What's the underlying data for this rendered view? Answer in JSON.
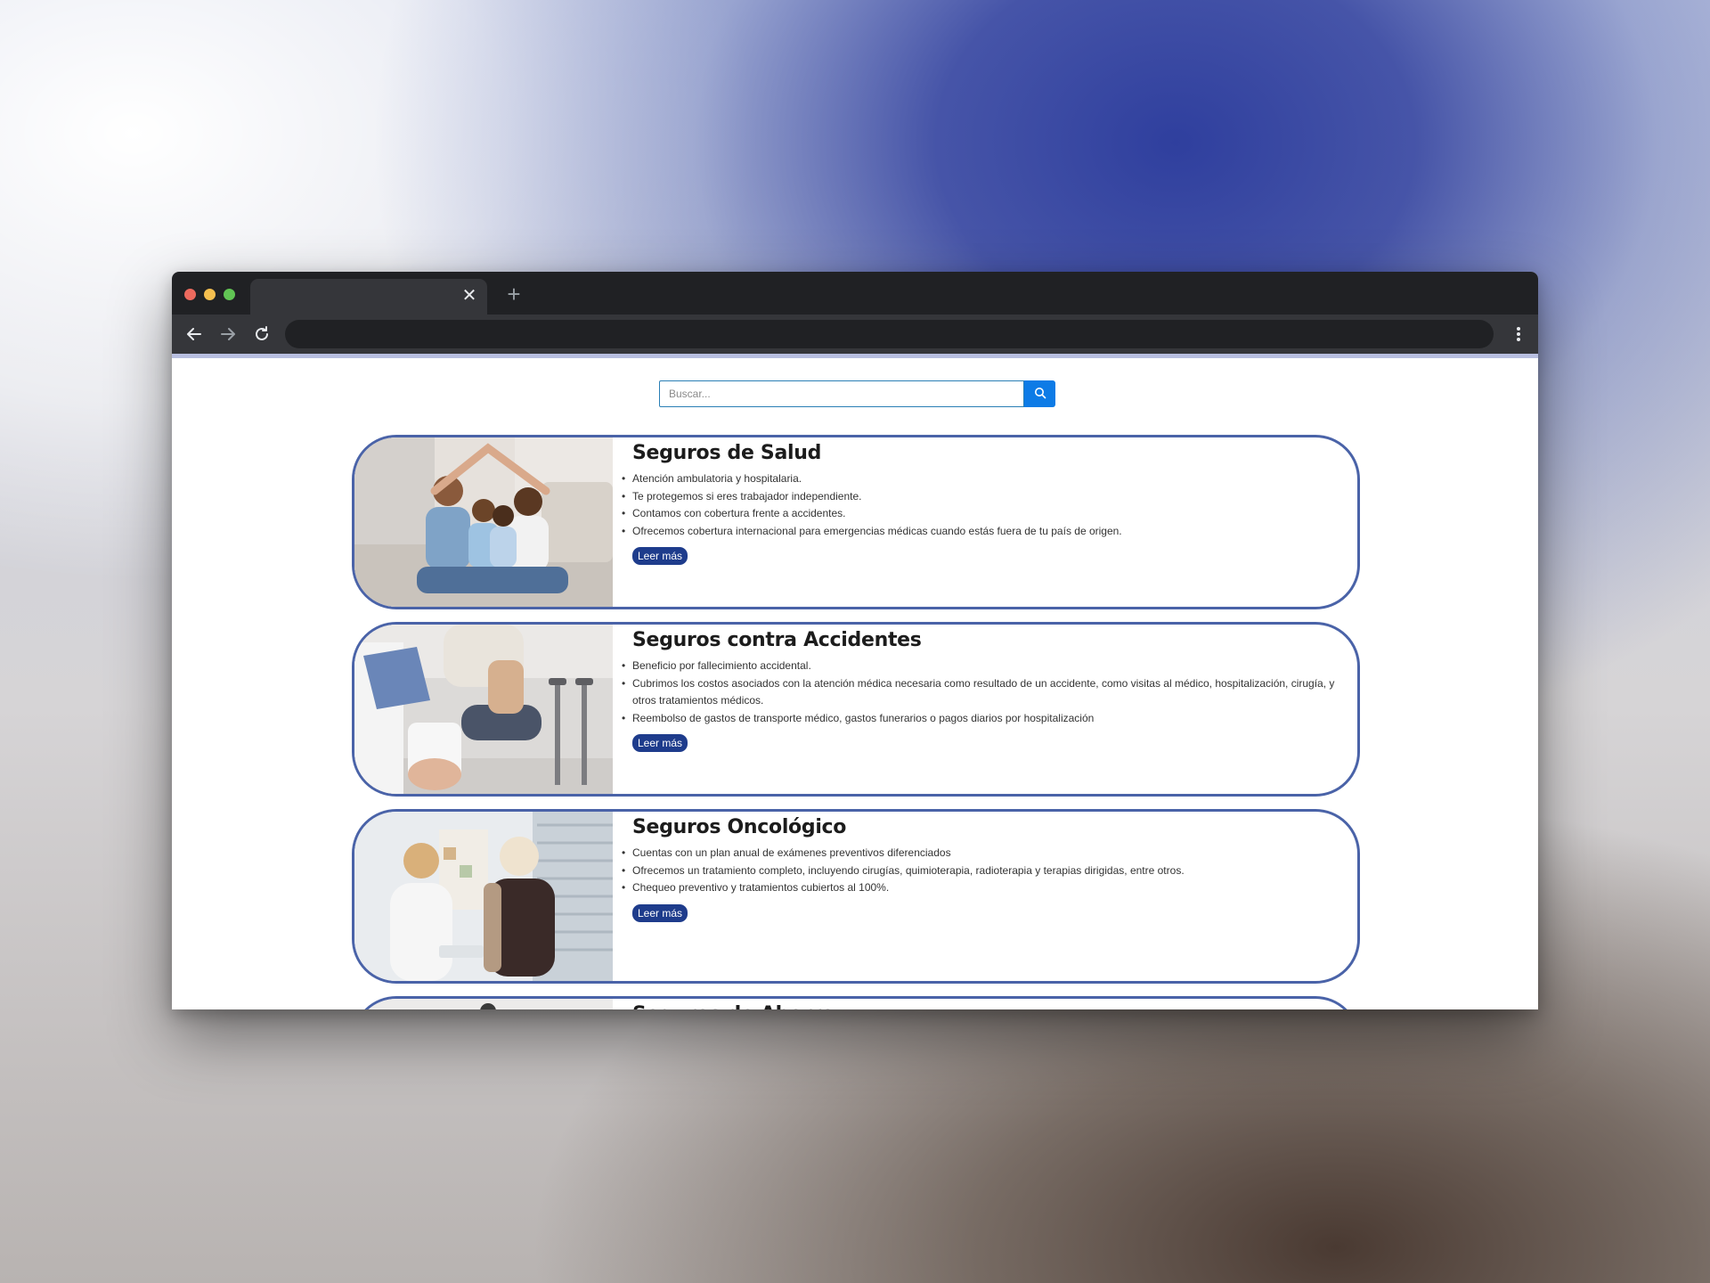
{
  "browser": {
    "tab_close": "✕",
    "new_tab": "+"
  },
  "search": {
    "placeholder": "Buscar..."
  },
  "cards": [
    {
      "title": "Seguros de Salud",
      "image": "family-photo",
      "items": [
        "Atención ambulatoria y hospitalaria.",
        "Te protegemos si eres trabajador independiente.",
        "Contamos con cobertura frente a accidentes.",
        "Ofrecemos cobertura internacional para emergencias médicas cuando estás fuera de tu país de origen."
      ],
      "button": "Leer más"
    },
    {
      "title": "Seguros contra Accidentes",
      "image": "injured-leg-crutches-photo",
      "items": [
        "Beneficio por fallecimiento accidental.",
        "Cubrimos los costos asociados con la atención médica necesaria como resultado de un accidente, como visitas al médico, hospitalización, cirugía, y otros tratamientos médicos.",
        "Reembolso de gastos de transporte médico, gastos funerarios o pagos diarios por hospitalización"
      ],
      "button": "Leer más"
    },
    {
      "title": "Seguros Oncológico",
      "image": "doctor-patient-photo",
      "items": [
        "Cuentas con un plan anual de exámenes preventivos diferenciados",
        "Ofrecemos un tratamiento completo, incluyendo cirugías, quimioterapia, radioterapia y terapias dirigidas, entre otros.",
        "Chequeo preventivo y tratamientos cubiertos al 100%."
      ],
      "button": "Leer más"
    },
    {
      "title": "Seguros de Ahorro"
    }
  ],
  "colors": {
    "card_border": "#4a63a8",
    "button_bg": "#1e3c8c",
    "search_button": "#0d7be6"
  }
}
